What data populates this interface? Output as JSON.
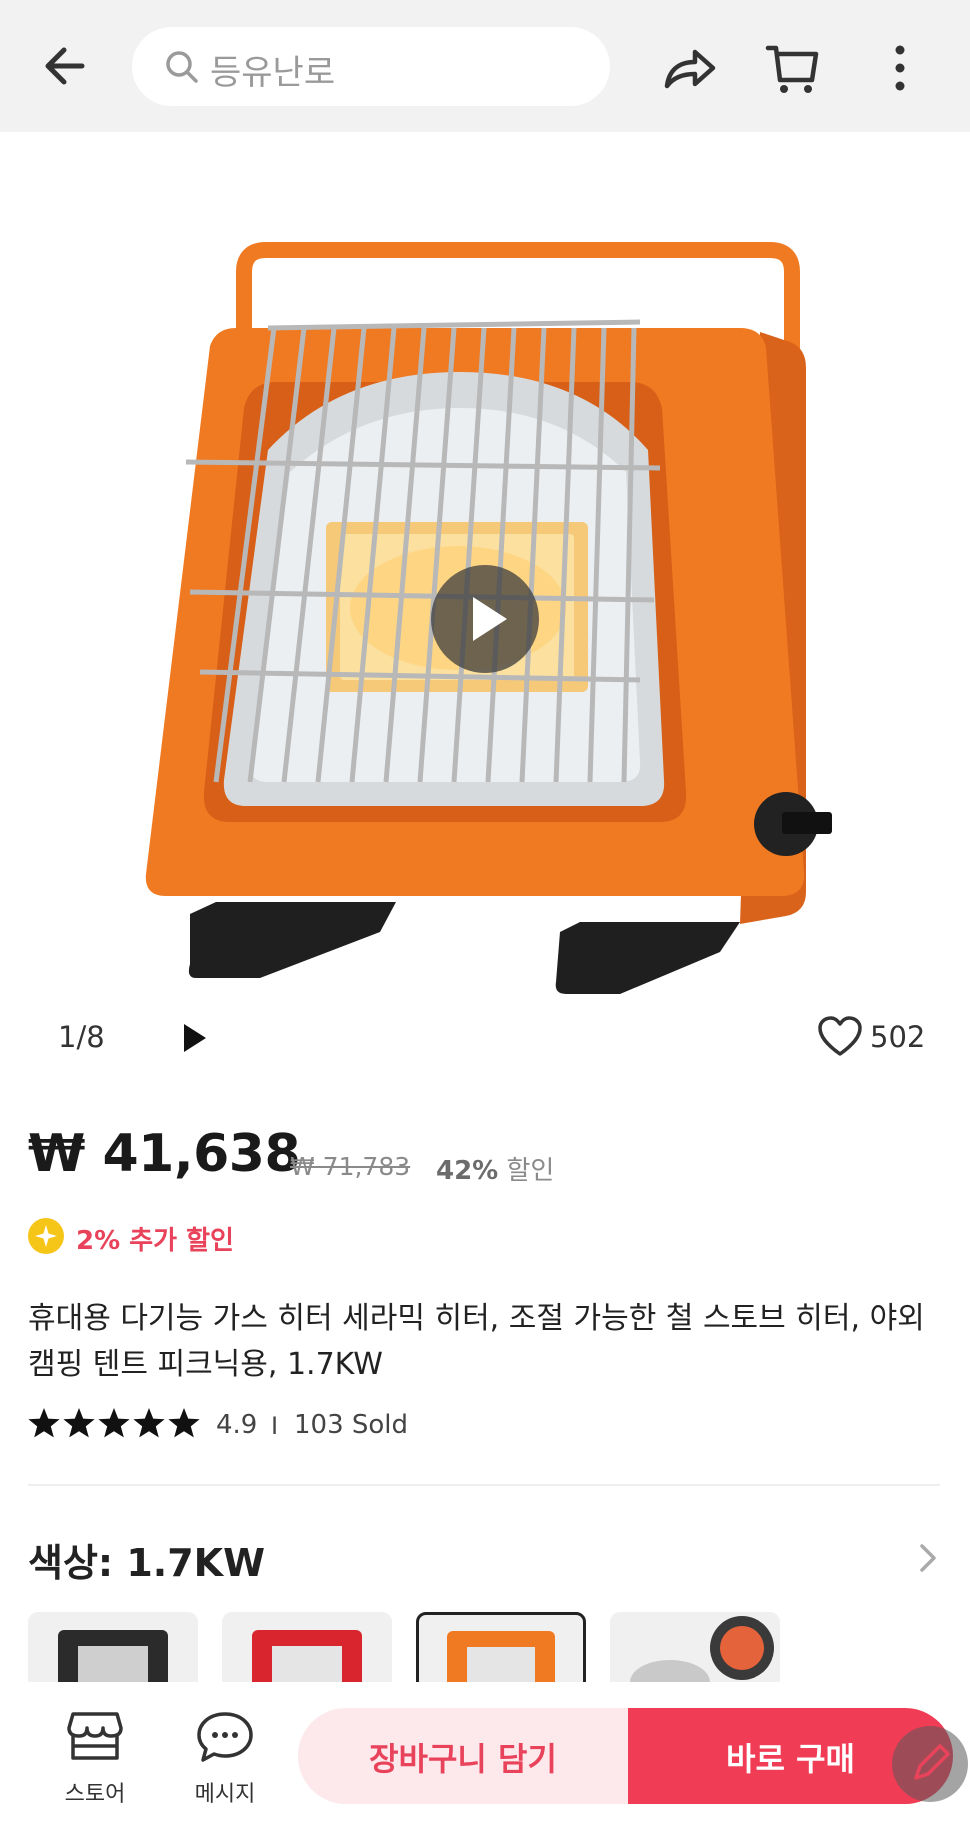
{
  "header": {
    "search_placeholder": "등유난로"
  },
  "gallery": {
    "counter": "1/8",
    "like_count": "502"
  },
  "price": {
    "current": "₩ 41,638",
    "original": "₩ 71,783",
    "discount_pct": "42%",
    "discount_word": "할인",
    "extra_discount": "2% 추가 할인"
  },
  "product": {
    "title": "휴대용 다기능 가스 히터 세라믹 히터, 조절 가능한 철 스토브 히터, 야외 캠핑 텐트 피크닉용, 1.7KW",
    "rating": "4.9",
    "rating_stars": 5,
    "separator": "I",
    "sold": "103 Sold"
  },
  "option": {
    "label": "색상: 1.7KW"
  },
  "bottom": {
    "store_label": "스토어",
    "message_label": "메시지",
    "add_to_cart": "장바구니 담기",
    "buy_now": "바로 구매"
  },
  "colors": {
    "accent": "#f03c55",
    "accent_light": "#fde8ec",
    "heater_orange": "#f07a22",
    "header_bg": "#f2f2f2"
  }
}
